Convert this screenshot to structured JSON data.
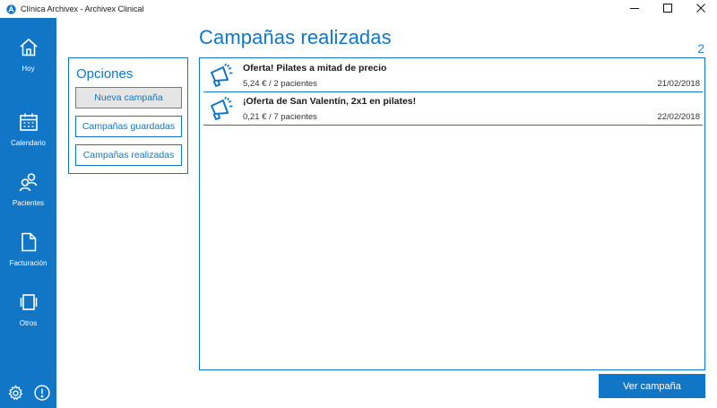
{
  "window": {
    "title": "Clínica Archivex - Archivex Clinical",
    "app_icon": "archivex-logo-icon",
    "controls": [
      "minimize-icon",
      "maximize-icon",
      "close-icon"
    ]
  },
  "sidebar": {
    "background_color": "#1276c6",
    "items": [
      {
        "label": "Hoy",
        "icon": "home-icon"
      },
      {
        "label": "Calendario",
        "icon": "calendar-icon"
      },
      {
        "label": "Pacientes",
        "icon": "patients-icon"
      },
      {
        "label": "Facturación",
        "icon": "document-icon"
      },
      {
        "label": "Otros",
        "icon": "more-icon"
      }
    ],
    "bottom_icons": [
      "settings-icon",
      "info-icon"
    ]
  },
  "main": {
    "title": "Campañas realizadas",
    "count": "2",
    "accent_color": "#1276c6"
  },
  "options": {
    "title": "Opciones",
    "buttons": [
      {
        "label": "Nueva campaña",
        "active": true
      },
      {
        "label": "Campañas guardadas",
        "active": false
      },
      {
        "label": "Campañas realizadas",
        "active": false
      }
    ]
  },
  "campaigns": [
    {
      "title": "Oferta! Pilates a mitad de precio",
      "summary": "5,24 € / 2 pacientes",
      "date": "21/02/2018",
      "icon": "megaphone-icon"
    },
    {
      "title": "¡Oferta de San Valentín, 2x1 en pilates!",
      "summary": "0,21 € / 7 pacientes",
      "date": "22/02/2018",
      "icon": "megaphone-icon"
    }
  ],
  "actions": {
    "view_campaign": "Ver campaña"
  }
}
